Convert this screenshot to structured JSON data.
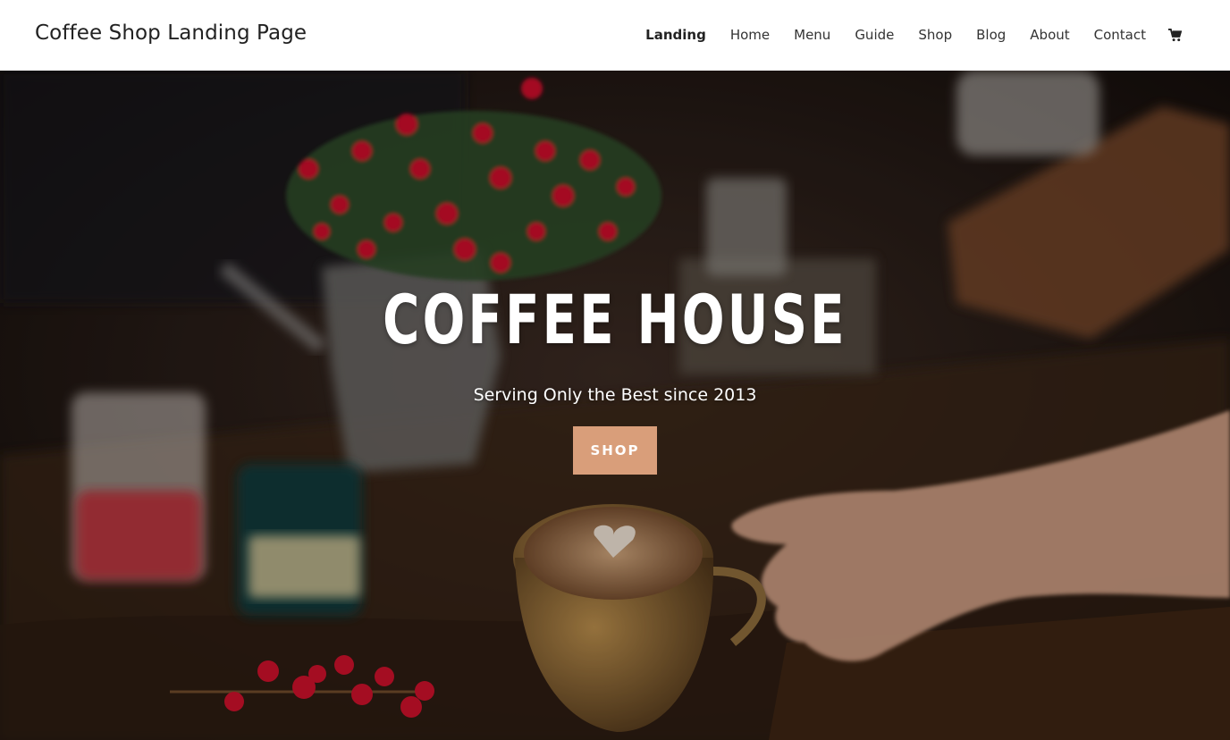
{
  "header": {
    "site_title": "Coffee Shop Landing Page",
    "nav": [
      "Landing",
      "Home",
      "Menu",
      "Guide",
      "Shop",
      "Blog",
      "About",
      "Contact"
    ],
    "active_nav": "Landing",
    "cart_icon": "shopping-cart-icon"
  },
  "hero": {
    "title": "COFFEE HOUSE",
    "subtitle": "Serving Only the Best since 2013",
    "button_label": "SHOP",
    "button_color": "#d99e7a"
  }
}
